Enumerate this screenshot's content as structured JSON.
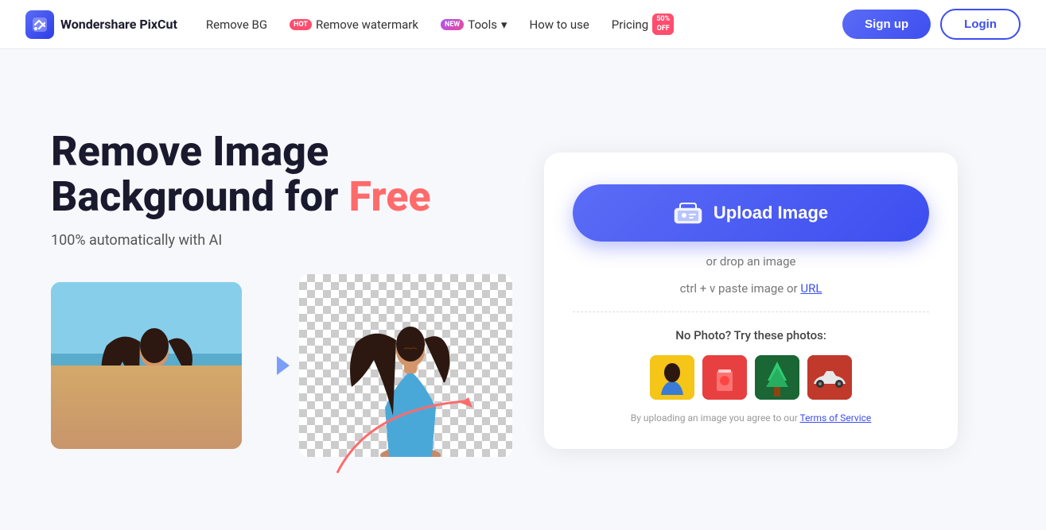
{
  "brand": {
    "name": "Wondershare PixCut",
    "logo_icon": "✂"
  },
  "nav": {
    "links": [
      {
        "id": "remove-bg",
        "label": "Remove BG",
        "badge": null
      },
      {
        "id": "remove-watermark",
        "label": "Remove watermark",
        "badge": "HOT"
      },
      {
        "id": "tools",
        "label": "Tools",
        "badge": "NEW",
        "has_chevron": true
      },
      {
        "id": "how-to-use",
        "label": "How to use",
        "badge": null
      },
      {
        "id": "pricing",
        "label": "Pricing",
        "badge": "50% OFF"
      }
    ],
    "signup_label": "Sign up",
    "login_label": "Login"
  },
  "hero": {
    "title_line1": "Remove Image",
    "title_line2": "Background for ",
    "title_free": "Free",
    "subtitle": "100% automatically with AI"
  },
  "upload_area": {
    "button_label": "Upload Image",
    "drop_text": "or drop an image",
    "paste_text": "ctrl + v paste image or ",
    "paste_url_label": "URL",
    "no_photo_label": "No Photo? Try these photos:",
    "terms_prefix": "By uploading an image you agree to our ",
    "terms_link_label": "Terms of Service"
  },
  "sample_photos": [
    {
      "id": "sample-1",
      "label": "Person with yellow",
      "color": "#f5c542"
    },
    {
      "id": "sample-2",
      "label": "Red drink",
      "color": "#e84040"
    },
    {
      "id": "sample-3",
      "label": "Forest",
      "color": "#27ae60"
    },
    {
      "id": "sample-4",
      "label": "Car",
      "color": "#c0392b"
    }
  ],
  "colors": {
    "primary": "#3d4ef0",
    "accent": "#ff6b6b",
    "hot_badge": "#ff4d6d",
    "new_badge_start": "#a855f7",
    "new_badge_end": "#ec4899"
  }
}
